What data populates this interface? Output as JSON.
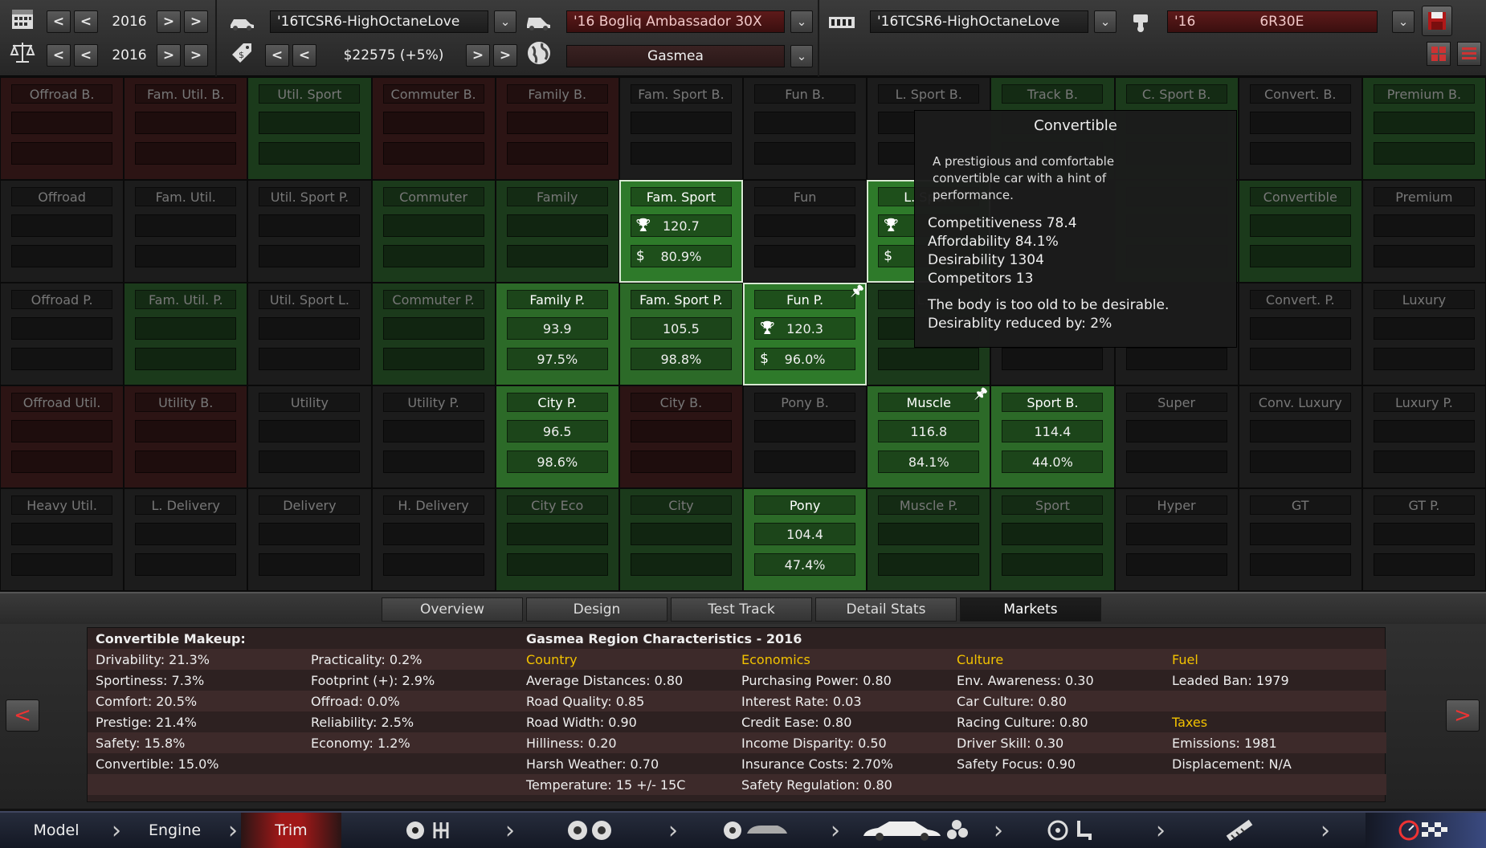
{
  "topbar": {
    "row1": {
      "year": "2016",
      "car_left": "'16TCSR6-HighOctaneLove",
      "car_right": "'16 Bogliq Ambassador 30X",
      "engine_left": "'16TCSR6-HighOctaneLove",
      "engine_right_year": "'16",
      "engine_right": "6R30E"
    },
    "row2": {
      "year": "2016",
      "price": "$22575 (+5%)",
      "region": "Gasmea"
    },
    "icons": [
      "calendar-icon",
      "balance-icon",
      "car-icon",
      "price-tag-icon",
      "globe-icon",
      "engine-icon",
      "piston-icon",
      "save-icon",
      "grid-view-icon",
      "list-view-icon"
    ]
  },
  "grid": {
    "rows": [
      [
        {
          "label": "Offroad B.",
          "v1": "",
          "v2": "",
          "style": "red"
        },
        {
          "label": "Fam. Util. B.",
          "v1": "",
          "v2": "",
          "style": "red"
        },
        {
          "label": "Util. Sport",
          "v1": "",
          "v2": "",
          "style": "green"
        },
        {
          "label": "Commuter B.",
          "v1": "",
          "v2": "",
          "style": "red"
        },
        {
          "label": "Family B.",
          "v1": "",
          "v2": "",
          "style": "red"
        },
        {
          "label": "Fam. Sport B.",
          "v1": "",
          "v2": "",
          "style": "dark"
        },
        {
          "label": "Fun B.",
          "v1": "",
          "v2": "",
          "style": "dark"
        },
        {
          "label": "L. Sport B.",
          "v1": "",
          "v2": "",
          "style": "dark"
        },
        {
          "label": "Track B.",
          "v1": "",
          "v2": "",
          "style": "green"
        },
        {
          "label": "C. Sport B.",
          "v1": "",
          "v2": "",
          "style": "green"
        },
        {
          "label": "Convert. B.",
          "v1": "",
          "v2": "",
          "style": "dark"
        },
        {
          "label": "Premium B.",
          "v1": "",
          "v2": "",
          "style": "green"
        }
      ],
      [
        {
          "label": "Offroad",
          "v1": "",
          "v2": "",
          "style": "dark"
        },
        {
          "label": "Fam. Util.",
          "v1": "",
          "v2": "",
          "style": "dark"
        },
        {
          "label": "Util. Sport P.",
          "v1": "",
          "v2": "",
          "style": "dark"
        },
        {
          "label": "Commuter",
          "v1": "",
          "v2": "",
          "style": "green"
        },
        {
          "label": "Family",
          "v1": "",
          "v2": "",
          "style": "green"
        },
        {
          "label": "Fam. Sport",
          "v1": "120.7",
          "v2": "80.9%",
          "style": "sel",
          "icons": true
        },
        {
          "label": "Fun",
          "v1": "",
          "v2": "",
          "style": "dark"
        },
        {
          "label": "L. Sport",
          "v1": "",
          "v2": "",
          "style": "sel",
          "icons": true
        },
        {
          "label": "",
          "v1": "",
          "v2": "",
          "style": "dark"
        },
        {
          "label": "",
          "v1": "",
          "v2": "",
          "style": "green"
        },
        {
          "label": "Convertible",
          "v1": "",
          "v2": "",
          "style": "green"
        },
        {
          "label": "Premium",
          "v1": "",
          "v2": "",
          "style": "dark"
        }
      ],
      [
        {
          "label": "Offroad P.",
          "v1": "",
          "v2": "",
          "style": "dark"
        },
        {
          "label": "Fam. Util. P.",
          "v1": "",
          "v2": "",
          "style": "green"
        },
        {
          "label": "Util. Sport L.",
          "v1": "",
          "v2": "",
          "style": "dark"
        },
        {
          "label": "Commuter P.",
          "v1": "",
          "v2": "",
          "style": "green"
        },
        {
          "label": "Family P.",
          "v1": "93.9",
          "v2": "97.5%",
          "style": "bright"
        },
        {
          "label": "Fam. Sport P.",
          "v1": "105.5",
          "v2": "98.8%",
          "style": "bright"
        },
        {
          "label": "Fun P.",
          "v1": "120.3",
          "v2": "96.0%",
          "style": "sel",
          "icons": true,
          "pin": true
        },
        {
          "label": "L. S",
          "v1": "",
          "v2": "",
          "style": "green"
        },
        {
          "label": "",
          "v1": "",
          "v2": "",
          "style": "dark"
        },
        {
          "label": "",
          "v1": "",
          "v2": "",
          "style": "dark"
        },
        {
          "label": "Convert. P.",
          "v1": "",
          "v2": "",
          "style": "dark"
        },
        {
          "label": "Luxury",
          "v1": "",
          "v2": "",
          "style": "dark"
        }
      ],
      [
        {
          "label": "Offroad Util.",
          "v1": "",
          "v2": "",
          "style": "red"
        },
        {
          "label": "Utility B.",
          "v1": "",
          "v2": "",
          "style": "red"
        },
        {
          "label": "Utility",
          "v1": "",
          "v2": "",
          "style": "dark"
        },
        {
          "label": "Utility P.",
          "v1": "",
          "v2": "",
          "style": "dark"
        },
        {
          "label": "City P.",
          "v1": "96.5",
          "v2": "98.6%",
          "style": "bright"
        },
        {
          "label": "City B.",
          "v1": "",
          "v2": "",
          "style": "red"
        },
        {
          "label": "Pony B.",
          "v1": "",
          "v2": "",
          "style": "dark"
        },
        {
          "label": "Muscle",
          "v1": "116.8",
          "v2": "84.1%",
          "style": "bright",
          "pin": true
        },
        {
          "label": "Sport B.",
          "v1": "114.4",
          "v2": "44.0%",
          "style": "bright"
        },
        {
          "label": "Super",
          "v1": "",
          "v2": "",
          "style": "dark"
        },
        {
          "label": "Conv. Luxury",
          "v1": "",
          "v2": "",
          "style": "dark"
        },
        {
          "label": "Luxury P.",
          "v1": "",
          "v2": "",
          "style": "dark"
        }
      ],
      [
        {
          "label": "Heavy Util.",
          "v1": "",
          "v2": "",
          "style": "dark"
        },
        {
          "label": "L. Delivery",
          "v1": "",
          "v2": "",
          "style": "dark"
        },
        {
          "label": "Delivery",
          "v1": "",
          "v2": "",
          "style": "dark"
        },
        {
          "label": "H. Delivery",
          "v1": "",
          "v2": "",
          "style": "dark"
        },
        {
          "label": "City Eco",
          "v1": "",
          "v2": "",
          "style": "green"
        },
        {
          "label": "City",
          "v1": "",
          "v2": "",
          "style": "green"
        },
        {
          "label": "Pony",
          "v1": "104.4",
          "v2": "47.4%",
          "style": "bright"
        },
        {
          "label": "Muscle P.",
          "v1": "",
          "v2": "",
          "style": "green"
        },
        {
          "label": "Sport",
          "v1": "",
          "v2": "",
          "style": "green"
        },
        {
          "label": "Hyper",
          "v1": "",
          "v2": "",
          "style": "dark"
        },
        {
          "label": "GT",
          "v1": "",
          "v2": "",
          "style": "dark"
        },
        {
          "label": "GT P.",
          "v1": "",
          "v2": "",
          "style": "dark"
        }
      ]
    ]
  },
  "tooltip": {
    "title": "Convertible",
    "description": "A prestigious and comfortable convertible car with a hint of performance.",
    "stats": [
      "Competitiveness 78.4",
      "Affordability 84.1%",
      "Desirability 1304",
      "Competitors 13"
    ],
    "notes": [
      "The body is too old to be desirable.",
      "Desirablity reduced by: 2%"
    ]
  },
  "tabs": [
    {
      "label": "Overview",
      "active": false
    },
    {
      "label": "Design",
      "active": false
    },
    {
      "label": "Test Track",
      "active": false
    },
    {
      "label": "Detail Stats",
      "active": false
    },
    {
      "label": "Markets",
      "active": true
    }
  ],
  "info": {
    "makeup_title": "Convertible Makeup:",
    "makeup_col1": [
      "Drivability: 21.3%",
      "Sportiness: 7.3%",
      "Comfort: 20.5%",
      "Prestige: 21.4%",
      "Safety: 15.8%",
      "Convertible: 15.0%"
    ],
    "makeup_col2": [
      "Practicality: 0.2%",
      "Footprint (+): 2.9%",
      "Offroad: 0.0%",
      "Reliability: 2.5%",
      "Economy: 1.2%"
    ],
    "region_title": "Gasmea Region Characteristics - 2016",
    "country_title": "Country",
    "country": [
      "Average Distances: 0.80",
      "Road Quality: 0.85",
      "Road Width: 0.90",
      "Hilliness: 0.20",
      "Harsh Weather: 0.70",
      "Temperature: 15 +/- 15C"
    ],
    "economics_title": "Economics",
    "economics": [
      "Purchasing Power: 0.80",
      "Interest Rate: 0.03",
      "Credit Ease: 0.80",
      "Income Disparity: 0.50",
      "Insurance Costs: 2.70%",
      "Safety Regulation: 0.80"
    ],
    "culture_title": "Culture",
    "culture": [
      "Env. Awareness: 0.30",
      "Car Culture: 0.80",
      "Racing Culture: 0.80",
      "Driver Skill: 0.30",
      "Safety Focus: 0.90"
    ],
    "fuel_title": "Fuel",
    "fuel": [
      "Leaded Ban: 1979"
    ],
    "taxes_title": "Taxes",
    "taxes": [
      "Emissions: 1981",
      "Displacement: N/A"
    ]
  },
  "bottomnav": {
    "model": "Model",
    "engine": "Engine",
    "trim": "Trim",
    "active": "Trim",
    "icons": [
      "gearbox-icon",
      "wheels-icon",
      "suspension-icon",
      "body-icon",
      "interior-icon",
      "exhaust-icon",
      "test-drive-icon"
    ]
  }
}
